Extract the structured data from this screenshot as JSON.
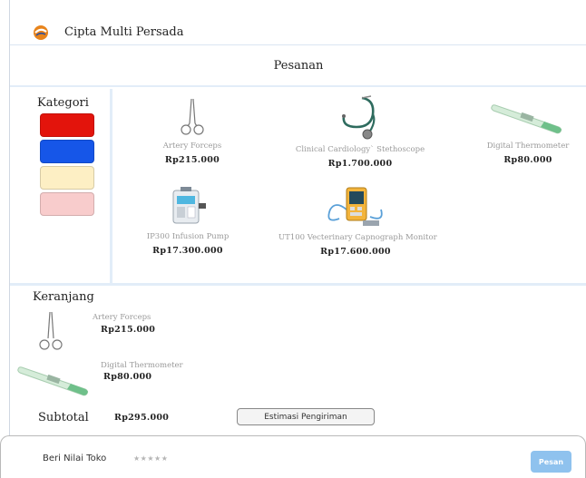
{
  "brand": {
    "name": "Cipta Multi Persada",
    "logo_icon": "cmp-logo-icon"
  },
  "order_header": {
    "title": "Pesanan"
  },
  "category": {
    "title": "Kategori",
    "swatches": [
      {
        "color": "#e3140c"
      },
      {
        "color": "#1656e8"
      },
      {
        "color": "#fdefc4"
      },
      {
        "color": "#f8cccc"
      }
    ]
  },
  "catalog": {
    "products": [
      {
        "name": "Artery Forceps",
        "price": "Rp215.000",
        "icon": "forceps-icon"
      },
      {
        "name": "Clinical Cardiology` Stethoscope",
        "price": "Rp1.700.000",
        "icon": "stethoscope-icon"
      },
      {
        "name": "Digital Thermometer",
        "price": "Rp80.000",
        "icon": "thermometer-icon"
      },
      {
        "name": "IP300 Infusion Pump",
        "price": "Rp17.300.000",
        "icon": "infusion-pump-icon"
      },
      {
        "name": "UT100 Vecterinary Capnograph Monitor",
        "price": "Rp17.600.000",
        "icon": "capnograph-icon"
      }
    ]
  },
  "cart": {
    "title": "Keranjang",
    "items": [
      {
        "name": "Artery Forceps",
        "price": "Rp215.000",
        "icon": "forceps-icon"
      },
      {
        "name": "Digital Thermometer",
        "price": "Rp80.000",
        "icon": "thermometer-icon"
      }
    ],
    "subtotal_label": "Subtotal",
    "subtotal_value": "Rp295.000",
    "shipping_button": "Estimasi Pengiriman"
  },
  "footer": {
    "rate_label": "Beri Nilai Toko",
    "stars": "★★★★★",
    "order_button": "Pesan"
  }
}
